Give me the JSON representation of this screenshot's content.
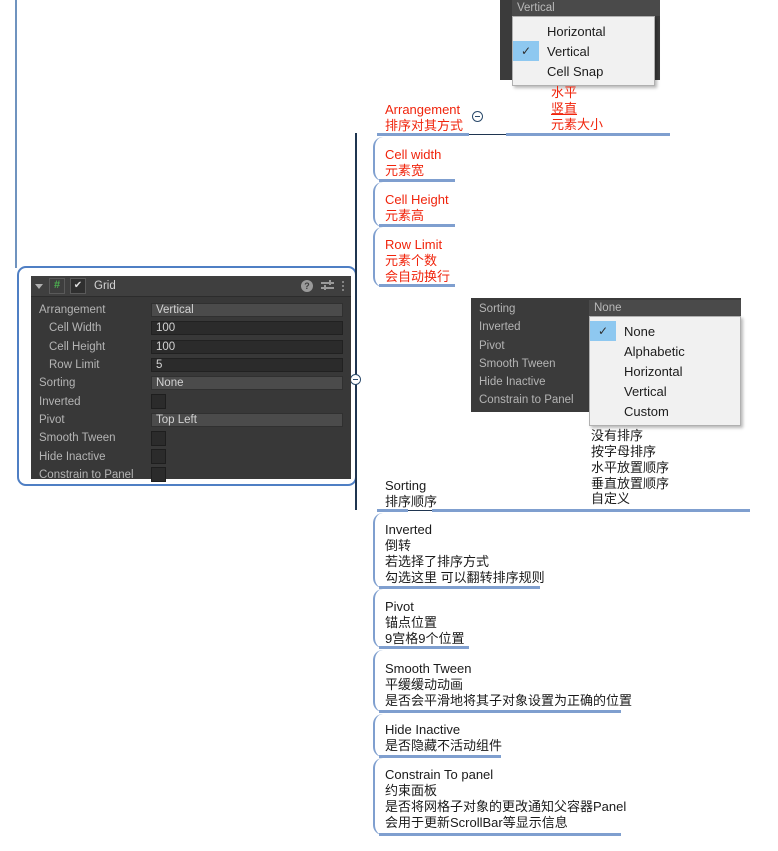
{
  "inspector": {
    "title": "Grid",
    "script_icon": "#",
    "enabled_icon": "✔",
    "header_icons": [
      "help-icon",
      "preset-icon",
      "more-icon"
    ],
    "rows": [
      {
        "label": "Arrangement",
        "type": "enum",
        "value": "Vertical"
      },
      {
        "label": "Cell Width",
        "type": "number",
        "value": "100",
        "indent": true
      },
      {
        "label": "Cell Height",
        "type": "number",
        "value": "100",
        "indent": true
      },
      {
        "label": "Row Limit",
        "type": "number",
        "value": "5",
        "indent": true
      },
      {
        "label": "Sorting",
        "type": "enum",
        "value": "None"
      },
      {
        "label": "Inverted",
        "type": "checkbox",
        "value": ""
      },
      {
        "label": "Pivot",
        "type": "enum",
        "value": "Top Left"
      },
      {
        "label": "Smooth Tween",
        "type": "checkbox",
        "value": ""
      },
      {
        "label": "Hide Inactive",
        "type": "checkbox",
        "value": ""
      },
      {
        "label": "Constrain to Panel",
        "type": "checkbox",
        "value": ""
      }
    ]
  },
  "arrangement_popup": {
    "value": "Vertical",
    "items": [
      {
        "label": "Horizontal",
        "checked": false
      },
      {
        "label": "Vertical",
        "checked": true
      },
      {
        "label": "Cell Snap",
        "checked": false
      }
    ],
    "check_glyph": "✓"
  },
  "sorting_popup": {
    "value": "None",
    "context_labels": [
      "Sorting",
      "Inverted",
      "Pivot",
      "Smooth Tween",
      "Hide Inactive",
      "Constrain to Panel"
    ],
    "items": [
      {
        "label": "None",
        "checked": true
      },
      {
        "label": "Alphabetic",
        "checked": false
      },
      {
        "label": "Horizontal",
        "checked": false
      },
      {
        "label": "Vertical",
        "checked": false
      },
      {
        "label": "Custom",
        "checked": false
      }
    ],
    "check_glyph": "✓"
  },
  "annotations": {
    "arrangement": {
      "l1": "Arrangement",
      "l2": "排序对其方式"
    },
    "arrangement_options": {
      "l1": "水平",
      "l2": "竖直",
      "l3": "元素大小"
    },
    "cell_width": {
      "l1": "Cell width",
      "l2": "元素宽"
    },
    "cell_height": {
      "l1": "Cell Height",
      "l2": "元素高"
    },
    "row_limit": {
      "l1": "Row Limit",
      "l2": "元素个数",
      "l3": "会自动换行"
    },
    "sorting": {
      "l1": "Sorting",
      "l2": "排序顺序"
    },
    "sorting_options": {
      "l1": "没有排序",
      "l2": "按字母排序",
      "l3": "水平放置顺序",
      "l4": "垂直放置顺序",
      "l5": "自定义"
    },
    "inverted": {
      "l1": "Inverted",
      "l2": "倒转",
      "l3": "若选择了排序方式",
      "l4": "勾选这里 可以翻转排序规则"
    },
    "pivot": {
      "l1": "Pivot",
      "l2": "锚点位置",
      "l3": "9宫格9个位置"
    },
    "smooth_tween": {
      "l1": "Smooth Tween",
      "l2": "平缓缓动动画",
      "l3": "是否会平滑地将其子对象设置为正确的位置"
    },
    "hide_inactive": {
      "l1": "Hide Inactive",
      "l2": "是否隐藏不活动组件"
    },
    "constrain": {
      "l1": "Constrain To panel",
      "l2": "约束面板",
      "l3": "是否将网格子对象的更改通知父容器Panel",
      "l4": "会用于更新ScrollBar等显示信息"
    }
  },
  "colors": {
    "annotation_red": "#f0240c",
    "annotation_black": "#1a1a1a",
    "branch_blue": "#7f9fcf",
    "frame_blue": "#4f7fc4",
    "unity_bg": "#383838",
    "highlight_blue": "#8ec8f0"
  }
}
